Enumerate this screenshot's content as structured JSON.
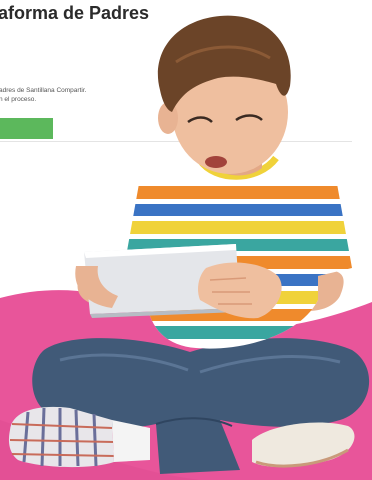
{
  "header": {
    "title": "aforma de Padres"
  },
  "intro": {
    "line1": "adres de Santillana Compartir.",
    "line2": "n el proceso."
  },
  "cta": {
    "label": "",
    "color": "#5cb85c"
  },
  "hero": {
    "accent_color": "#e8559a",
    "shirt_stripe_colors": [
      "#f0d23a",
      "#ef8a2c",
      "#3a73c4",
      "#3aa6a0",
      "#ffffff"
    ],
    "icon": "child-with-tablet-illustration"
  }
}
